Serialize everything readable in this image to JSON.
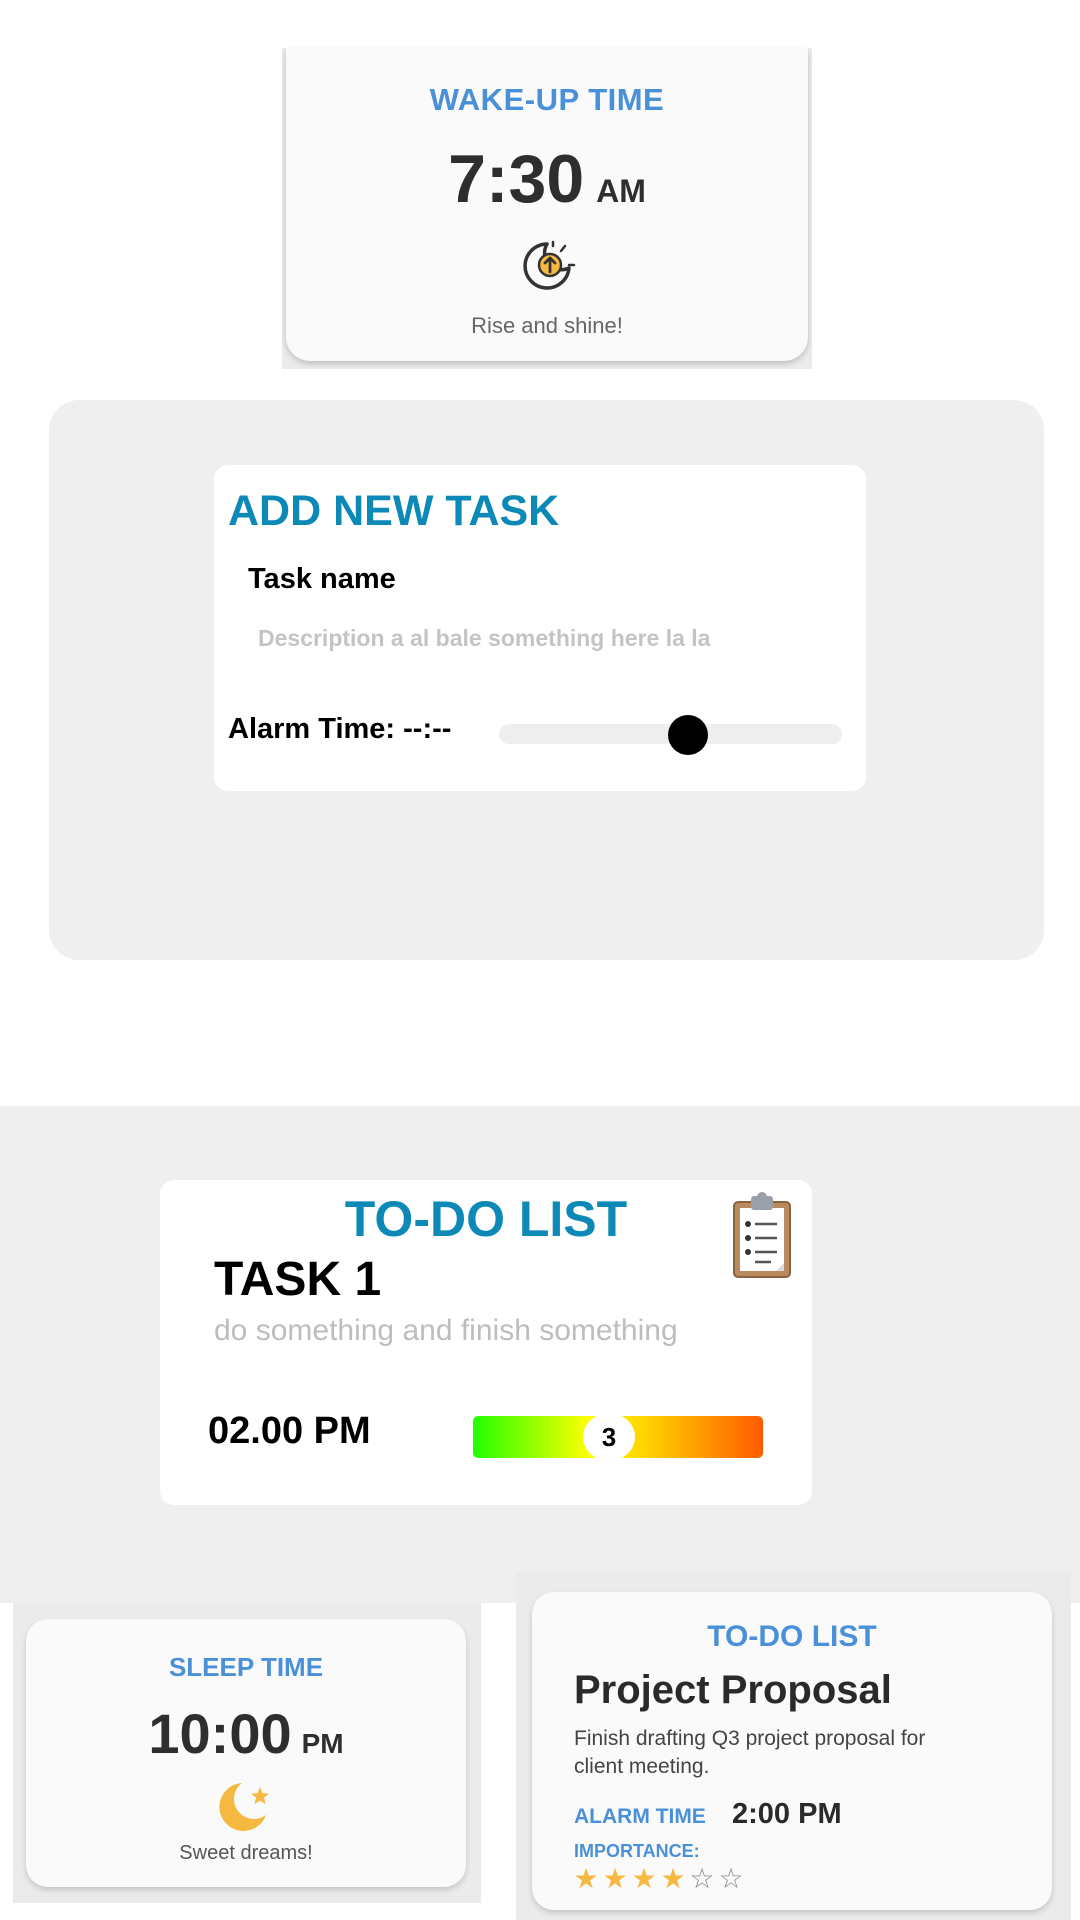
{
  "wake": {
    "title": "WAKE-UP TIME",
    "time": "7:30",
    "ampm": "AM",
    "icon": "sunrise-icon",
    "message": "Rise and shine!"
  },
  "add_task": {
    "title": "ADD NEW TASK",
    "name_label": "Task name",
    "description_placeholder": "Description a al bale something here la la",
    "alarm_label": "Alarm Time: --:--",
    "alarm_slider_level": 0.55
  },
  "todo": {
    "title": "TO-DO LIST",
    "icon": "clipboard-icon",
    "task_title": "TASK 1",
    "task_description": "do something and finish something",
    "time": "02.00 PM",
    "importance": "3"
  },
  "sleep": {
    "title": "SLEEP TIME",
    "time": "10:00",
    "ampm": "PM",
    "icon": "moon-star-icon",
    "message": "Sweet dreams!"
  },
  "project": {
    "header": "TO-DO LIST",
    "title": "Project Proposal",
    "description": "Finish drafting Q3 project proposal for client meeting.",
    "alarm_label": "ALARM TIME",
    "alarm_value": "2:00 PM",
    "importance_label": "IMPORTANCE:",
    "importance_stars": 4,
    "importance_max": 6
  },
  "colors": {
    "accent_blue": "#4a90d9",
    "teal_title": "#0d89b7",
    "star_gold": "#f5b942",
    "panel_grey": "#efefef"
  }
}
